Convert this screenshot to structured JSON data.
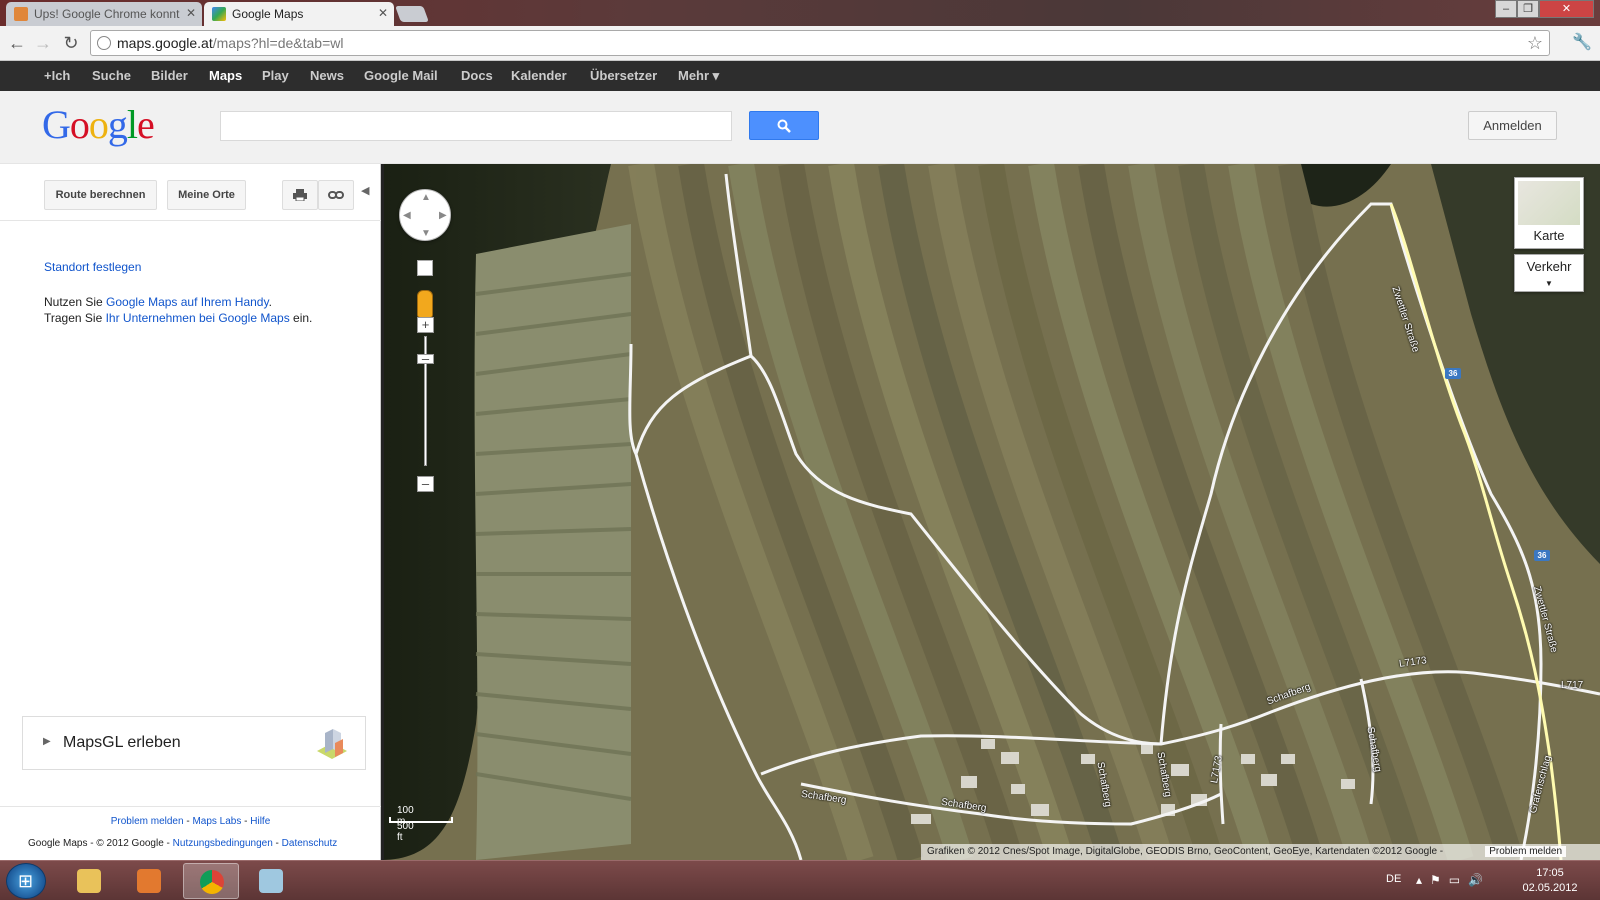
{
  "browser": {
    "tabs": [
      {
        "title": "Ups! Google Chrome konnt",
        "active": false
      },
      {
        "title": "Google Maps",
        "active": true
      }
    ],
    "address": {
      "host": "maps.google.at",
      "path": "/maps?hl=de&tab=wl"
    }
  },
  "gbar": {
    "items": [
      "+Ich",
      "Suche",
      "Bilder",
      "Maps",
      "Play",
      "News",
      "Google Mail",
      "Docs",
      "Kalender",
      "Übersetzer",
      "Mehr ▾"
    ],
    "selected": "Maps"
  },
  "header": {
    "logo": [
      "G",
      "o",
      "o",
      "g",
      "l",
      "e"
    ],
    "logo_colors": [
      "#3369e8",
      "#d50f25",
      "#eeb211",
      "#3369e8",
      "#009925",
      "#d50f25"
    ],
    "search_value": "",
    "search_icon": "magnifier-icon",
    "signin_label": "Anmelden"
  },
  "panel": {
    "route_label": "Route berechnen",
    "places_label": "Meine Orte",
    "print_icon": "printer-icon",
    "link_icon": "link-icon",
    "standort_label": "Standort festlegen",
    "line1_prefix": "Nutzen Sie ",
    "line1_link": "Google Maps auf Ihrem Handy",
    "line1_suffix": ".",
    "line2_prefix": "Tragen Sie ",
    "line2_link": "Ihr Unternehmen bei Google Maps",
    "line2_suffix": " ein.",
    "mapsgl_label": "MapsGL erleben",
    "footer_links": [
      "Problem melden",
      "Maps Labs",
      "Hilfe"
    ],
    "footer_copyright": "Google Maps - © 2012 Google - ",
    "footer_links2": [
      "Nutzungsbedingungen",
      "Datenschutz"
    ]
  },
  "map": {
    "maptype_label": "Karte",
    "traffic_label": "Verkehr",
    "scale_metric": "100 m",
    "scale_imperial": "500 ft",
    "copyright": "Grafiken © 2012 Cnes/Spot Image, DigitalGlobe, GEODIS Brno, GeoContent, GeoEye, Kartendaten ©2012 Google - ",
    "problem_label": "Problem melden",
    "road_labels": [
      "Zwettler Straße",
      "Zwettler Straße",
      "Schafberg",
      "Schafberg",
      "Schafberg",
      "Schafberg",
      "Schafberg",
      "L7173",
      "L7173",
      "L717",
      "Grafenschlag",
      "Schafberg"
    ],
    "route_shields": [
      "36",
      "36"
    ]
  },
  "taskbar": {
    "language": "DE",
    "time": "17:05",
    "date": "02.05.2012"
  }
}
